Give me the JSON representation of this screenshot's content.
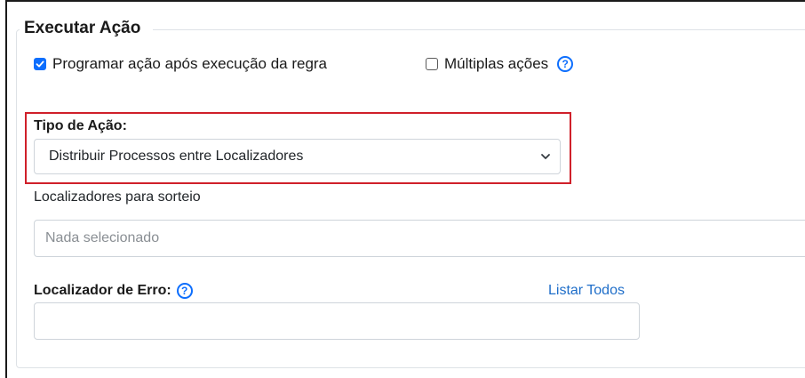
{
  "section": {
    "title": "Executar Ação"
  },
  "options": {
    "schedule_label": "Programar ação após execução da regra",
    "schedule_checked": true,
    "multiple_label": "Múltiplas ações",
    "multiple_checked": false,
    "help_glyph": "?"
  },
  "action_type": {
    "label": "Tipo de Ação:",
    "selected": "Distribuir Processos entre Localizadores"
  },
  "locators": {
    "label": "Localizadores para sorteio",
    "placeholder": "Nada selecionado"
  },
  "error_locator": {
    "label": "Localizador de Erro:",
    "help_glyph": "?",
    "list_all_label": "Listar Todos",
    "value": ""
  },
  "colors": {
    "accent": "#0d6efd",
    "highlight": "#d0202a",
    "link": "#1f6ec9"
  }
}
